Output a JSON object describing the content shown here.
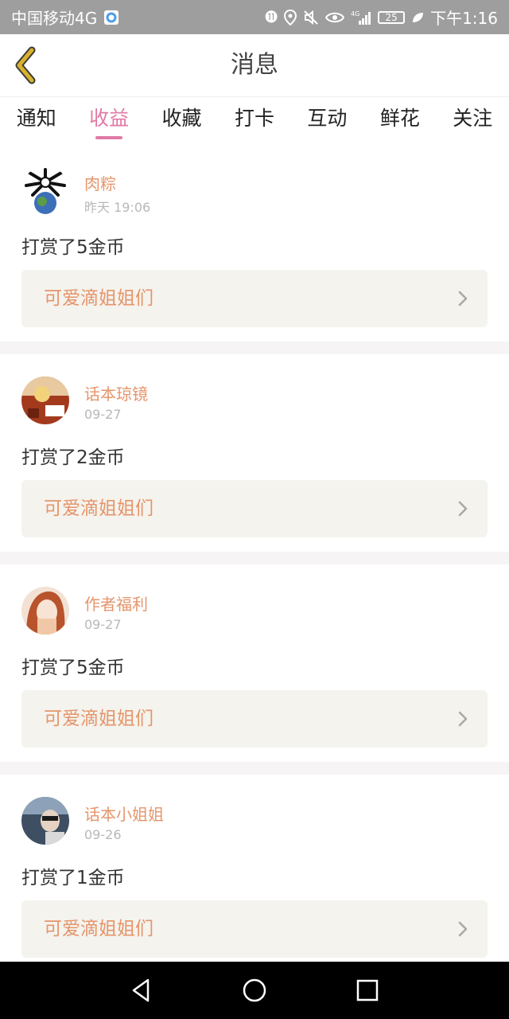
{
  "status_bar": {
    "carrier": "中国移动4G",
    "battery": "25",
    "time": "下午1:16",
    "icons": [
      "hd-icon",
      "location-icon",
      "mute-icon",
      "eye-icon",
      "signal-icon",
      "battery-icon",
      "leaf-icon"
    ]
  },
  "header": {
    "title": "消息",
    "back_icon": "chevron-left-icon"
  },
  "tabs": [
    {
      "label": "通知"
    },
    {
      "label": "收益",
      "active": true
    },
    {
      "label": "收藏"
    },
    {
      "label": "打卡"
    },
    {
      "label": "互动"
    },
    {
      "label": "鲜花"
    },
    {
      "label": "关注"
    }
  ],
  "messages": [
    {
      "user": "肉粽",
      "time": "昨天 19:06",
      "text": "打赏了5金币",
      "link": "可爱滴姐姐们"
    },
    {
      "user": "话本琼镜",
      "time": "09-27",
      "text": "打赏了2金币",
      "link": "可爱滴姐姐们"
    },
    {
      "user": "作者福利",
      "time": "09-27",
      "text": "打赏了5金币",
      "link": "可爱滴姐姐们"
    },
    {
      "user": "话本小姐姐",
      "time": "09-26",
      "text": "打赏了1金币",
      "link": "可爱滴姐姐们"
    }
  ],
  "colors": {
    "accent_pink": "#e07aa6",
    "name_orange": "#e6956b",
    "back_gold": "#c9a227",
    "link_bg": "#f4f3ee"
  }
}
